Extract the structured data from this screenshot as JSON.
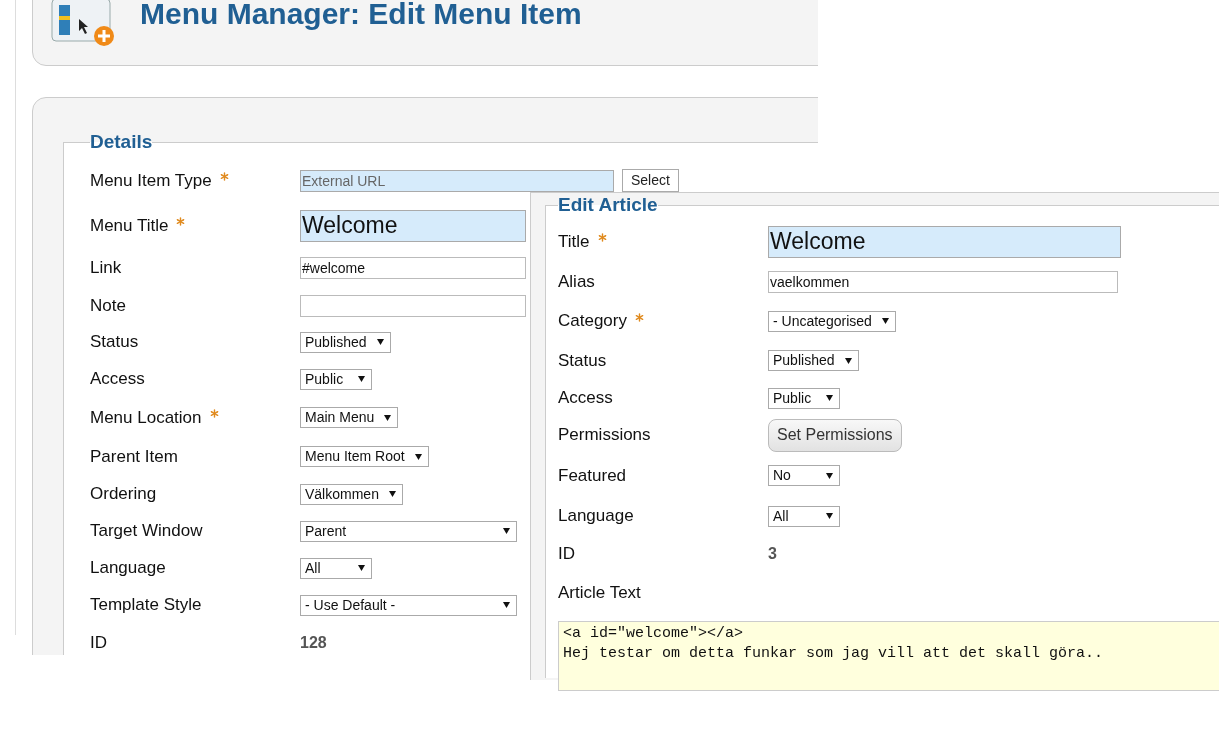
{
  "menu_manager": {
    "title": "Menu Manager: Edit Menu Item",
    "legend": "Details",
    "fields": [
      {
        "kind": "type_picker",
        "label": "Menu Item Type",
        "required": true,
        "value": "External URL",
        "button": "Select"
      },
      {
        "kind": "title",
        "label": "Menu Title",
        "required": true,
        "value": "Welcome"
      },
      {
        "kind": "text",
        "label": "Link",
        "required": false,
        "value": "#welcome"
      },
      {
        "kind": "text",
        "label": "Note",
        "required": false
      },
      {
        "kind": "select",
        "label": "Status",
        "required": false,
        "value": "Published"
      },
      {
        "kind": "select",
        "label": "Access",
        "required": false,
        "value": "Public"
      },
      {
        "kind": "select",
        "label": "Menu Location",
        "required": true,
        "value": "Main Menu"
      },
      {
        "kind": "select",
        "label": "Parent Item",
        "required": false,
        "value": "Menu Item Root"
      },
      {
        "kind": "select",
        "label": "Ordering",
        "required": false,
        "value": "Välkommen"
      },
      {
        "kind": "wide_select",
        "label": "Target Window",
        "required": false,
        "value": "Parent"
      },
      {
        "kind": "select",
        "label": "Language",
        "required": false,
        "value": "All"
      },
      {
        "kind": "wide_select",
        "label": "Template Style",
        "required": false,
        "value": "- Use Default -"
      },
      {
        "kind": "value",
        "label": "ID",
        "required": false,
        "value": "128"
      }
    ]
  },
  "edit_article": {
    "legend": "Edit Article",
    "fields": [
      {
        "kind": "title",
        "label": "Title",
        "required": true,
        "value": "Welcome"
      },
      {
        "kind": "text",
        "label": "Alias",
        "required": false,
        "value": "vaelkommen"
      },
      {
        "kind": "select",
        "label": "Category",
        "required": true,
        "value": "- Uncategorised"
      },
      {
        "kind": "select",
        "label": "Status",
        "required": false,
        "value": "Published"
      },
      {
        "kind": "select",
        "label": "Access",
        "required": false,
        "value": "Public"
      },
      {
        "kind": "button",
        "label": "Permissions",
        "required": false,
        "value": "Set Permissions"
      },
      {
        "kind": "select",
        "label": "Featured",
        "required": false,
        "value": "No"
      },
      {
        "kind": "select",
        "label": "Language",
        "required": false,
        "value": "All"
      },
      {
        "kind": "value",
        "label": "ID",
        "required": false,
        "value": "3"
      },
      {
        "kind": "label",
        "label": "Article Text",
        "required": false
      }
    ],
    "article_text": [
      "<a id=\"welcome\"></a>",
      "Hej testar om detta funkar som jag vill att det skall göra.."
    ]
  }
}
